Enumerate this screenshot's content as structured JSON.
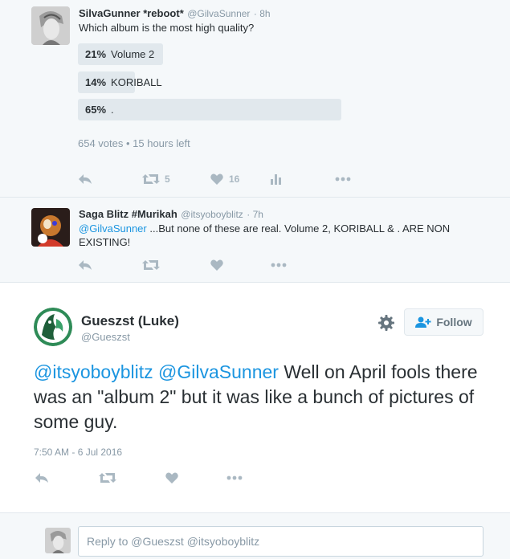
{
  "tweet1": {
    "name": "SilvaGunner *reboot*",
    "handle": "@GilvaSunner",
    "time": "· 8h",
    "text": "Which album is the most high quality?",
    "poll": [
      {
        "pct": "21%",
        "label": "Volume 2",
        "fraction": 0.21
      },
      {
        "pct": "14%",
        "label": "KORIBALL",
        "fraction": 0.14
      },
      {
        "pct": "65%",
        "label": ".",
        "fraction": 0.65
      }
    ],
    "poll_meta": "654 votes • 15 hours left",
    "retweets": "5",
    "likes": "16"
  },
  "tweet2": {
    "name": "Saga Blitz #Murikah",
    "handle": "@itsyoboyblitz",
    "time": "· 7h",
    "mention": "@GilvaSunner",
    "text": " ...But none of these are real. Volume 2, KORIBALL & . ARE NON EXISTING!"
  },
  "main": {
    "name": "Gueszst (Luke)",
    "handle": "@Gueszst",
    "follow_label": "Follow",
    "mention1": "@itsyoboyblitz",
    "mention2": "@GilvaSunner",
    "text": " Well on April fools there was an \"album 2\" but it was like a bunch of pictures of some guy.",
    "timestamp": "7:50 AM - 6 Jul 2016"
  },
  "reply": {
    "placeholder": "Reply to @Gueszst @itsyoboyblitz"
  },
  "colors": {
    "link": "#1b95e0",
    "poll_bar": "#e1e8ed",
    "icon": "#aab8c2"
  }
}
